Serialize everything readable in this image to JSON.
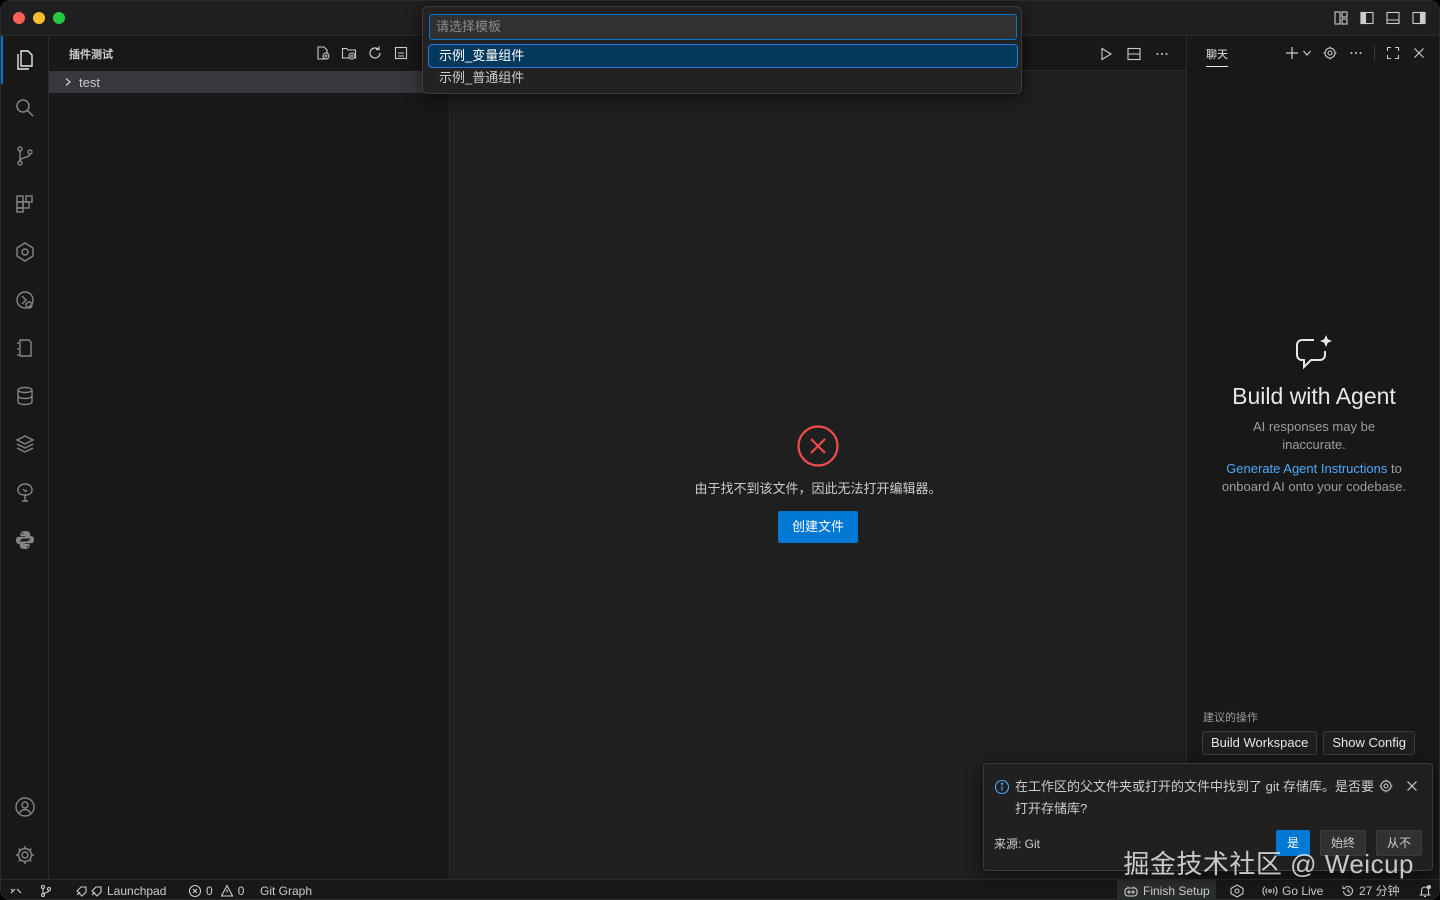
{
  "colors": {
    "accent": "#0078d4",
    "error": "#f14c4c",
    "link": "#4daafc"
  },
  "sidebar": {
    "title": "插件测试",
    "tree": [
      {
        "label": "test"
      }
    ]
  },
  "quick_pick": {
    "placeholder": "请选择模板",
    "items": [
      {
        "label": "示例_变量组件"
      },
      {
        "label": "示例_普通组件"
      }
    ]
  },
  "editor": {
    "error_message": "由于找不到该文件，因此无法打开编辑器。",
    "create_button": "创建文件"
  },
  "chat": {
    "tab": "聊天",
    "title": "Build with Agent",
    "subtitle": "AI responses may be inaccurate.",
    "link_text": "Generate Agent Instructions",
    "link_suffix": " to onboard AI onto your codebase.",
    "suggested_label": "建议的操作",
    "suggested_buttons": [
      "Build Workspace",
      "Show Config"
    ]
  },
  "notification": {
    "message": "在工作区的父文件夹或打开的文件中找到了 git 存储库。是否要打开存储库?",
    "source": "来源: Git",
    "buttons": {
      "yes": "是",
      "always": "始终",
      "never": "从不"
    }
  },
  "watermark": "掘金技术社区 @ Weicup",
  "statusbar": {
    "launchpad": "Launchpad",
    "errors": "0",
    "warnings": "0",
    "git_graph": "Git Graph",
    "finish_setup": "Finish Setup",
    "go_live": "Go Live",
    "time": "27 分钟"
  }
}
